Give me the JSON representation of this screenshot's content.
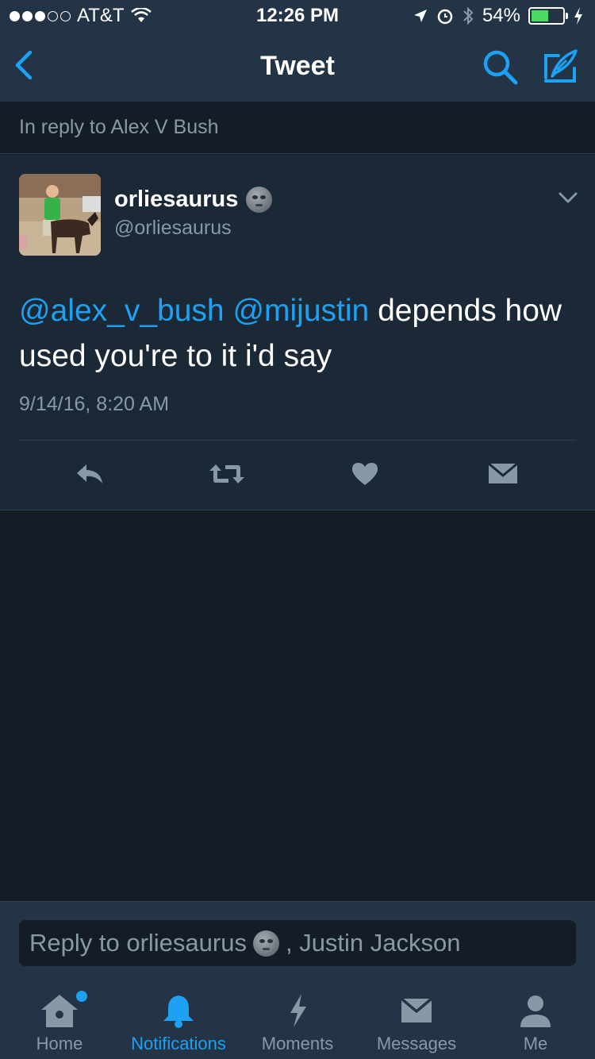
{
  "status_bar": {
    "carrier": "AT&T",
    "time": "12:26 PM",
    "battery": "54%",
    "battery_level": 0.54
  },
  "nav": {
    "title": "Tweet",
    "back_icon": "chevron-left-icon",
    "search_icon": "search-icon",
    "compose_icon": "compose-icon"
  },
  "reply_context": {
    "text": "In reply to Alex V Bush"
  },
  "tweet": {
    "display_name": "orliesaurus",
    "handle": "@orliesaurus",
    "mention1": "@alex_v_bush",
    "mention2": "@mijustin",
    "body": " depends how used you're to it i'd say",
    "timestamp": "9/14/16, 8:20 AM",
    "actions": [
      "reply-icon",
      "retweet-icon",
      "like-icon",
      "direct-message-icon"
    ]
  },
  "reply_box": {
    "prefix": "Reply to orliesaurus",
    "suffix": ", Justin Jackson"
  },
  "tabs": [
    {
      "label": "Home",
      "icon": "home-icon",
      "active": false
    },
    {
      "label": "Notifications",
      "icon": "bell-icon",
      "active": true
    },
    {
      "label": "Moments",
      "icon": "lightning-icon",
      "active": false
    },
    {
      "label": "Messages",
      "icon": "envelope-icon",
      "active": false
    },
    {
      "label": "Me",
      "icon": "person-icon",
      "active": false
    }
  ],
  "colors": {
    "accent": "#1da1f2",
    "background": "#141d26",
    "card": "#1b2836",
    "bar": "#243447",
    "secondary_text": "#8899a6"
  }
}
